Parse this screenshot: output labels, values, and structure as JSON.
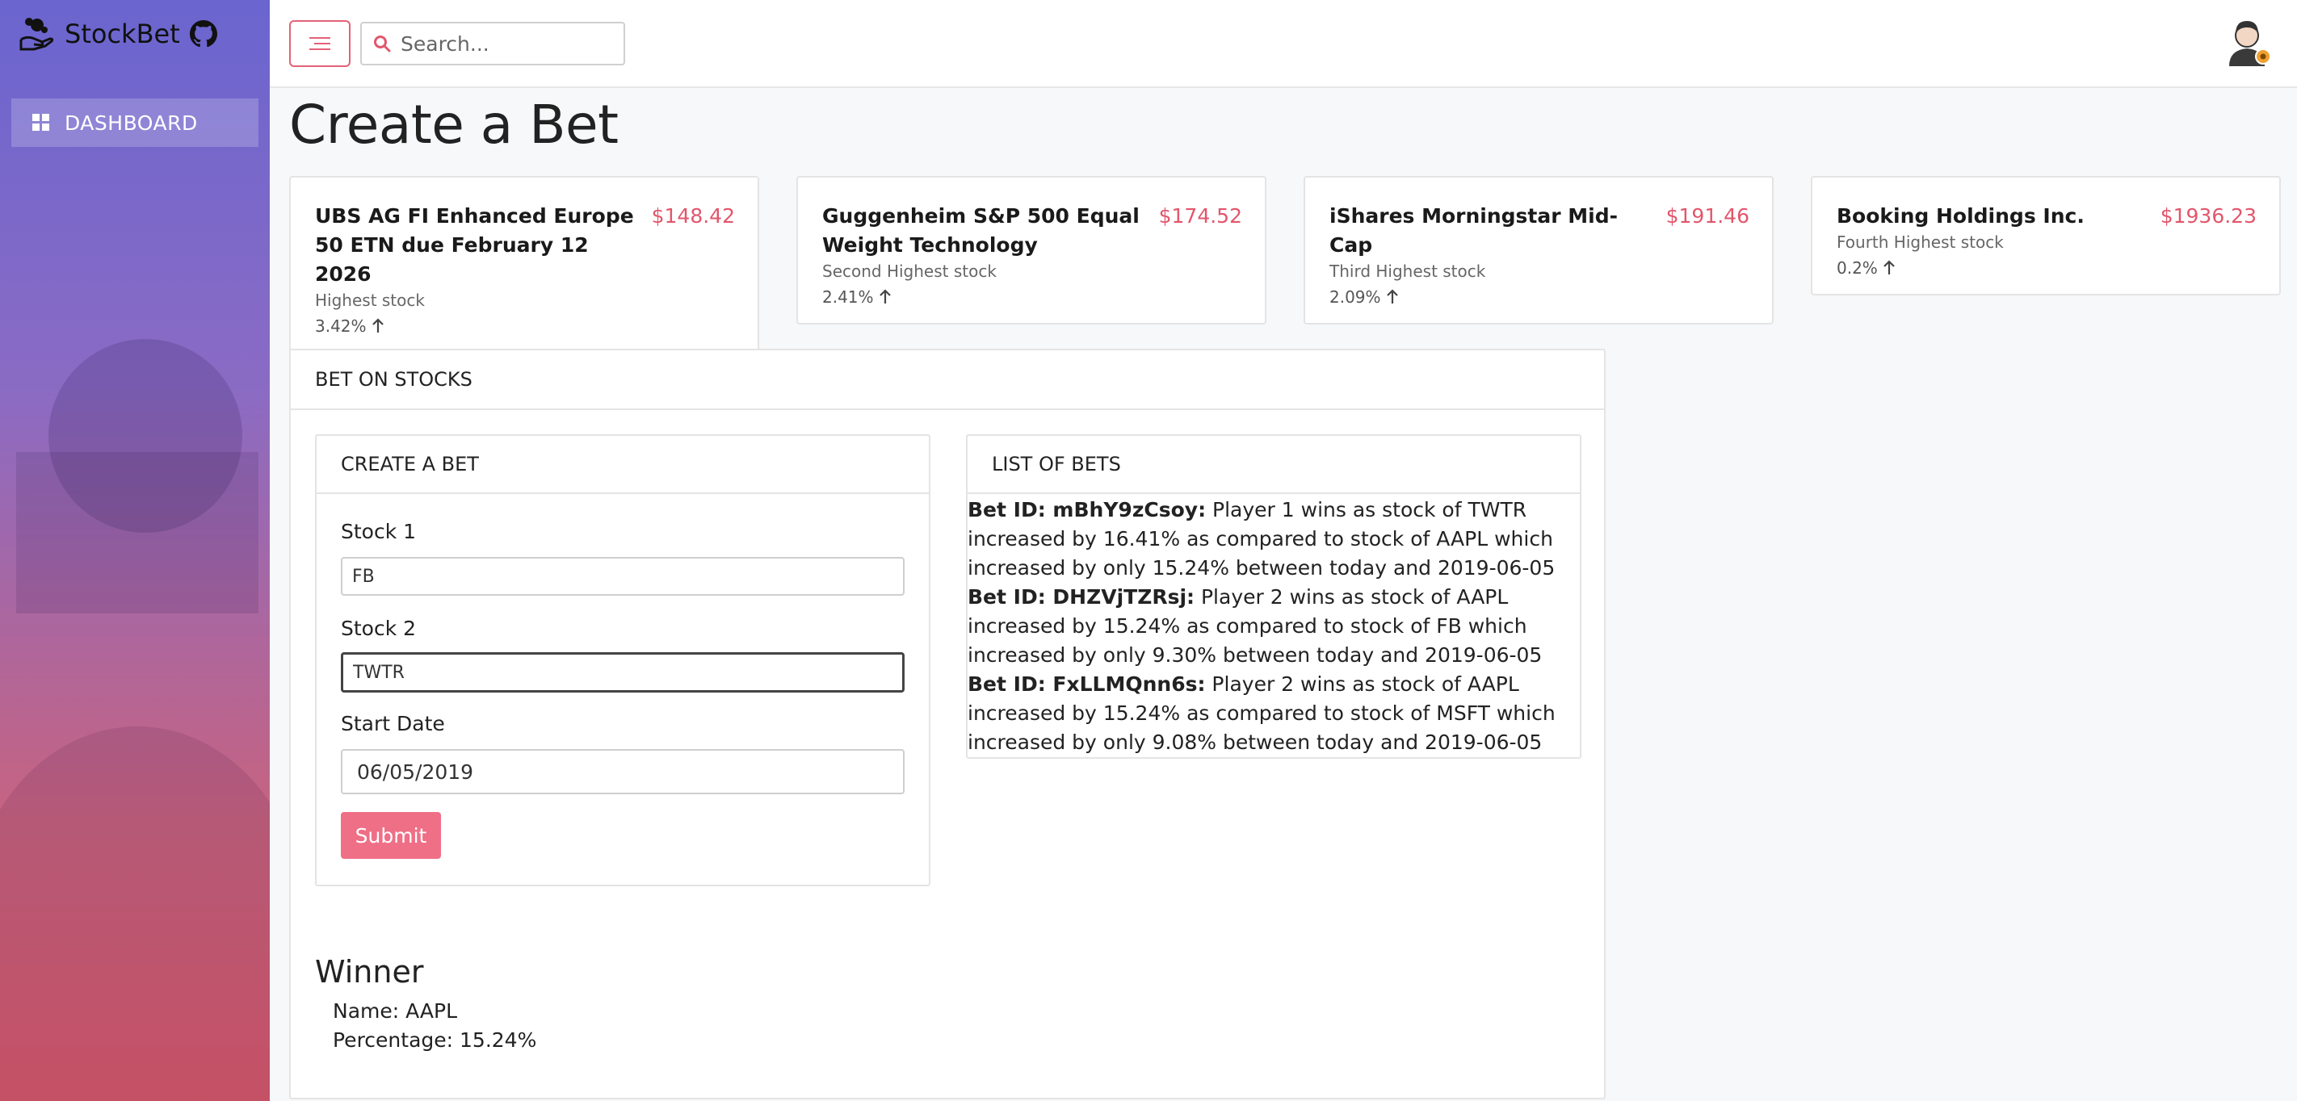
{
  "brand": {
    "name": "StockBet"
  },
  "sidebar": {
    "items": [
      {
        "label": "DASHBOARD",
        "icon": "dashboard-grid-icon"
      }
    ]
  },
  "topbar": {
    "search_placeholder": "Search..."
  },
  "page": {
    "title": "Create a Bet"
  },
  "top_stocks": [
    {
      "name": "UBS AG FI Enhanced Europe 50 ETN due February 12 2026",
      "price": "$148.42",
      "rank": "Highest stock",
      "change": "3.42%"
    },
    {
      "name": "Guggenheim S&P 500 Equal Weight Technology",
      "price": "$174.52",
      "rank": "Second Highest stock",
      "change": "2.41%"
    },
    {
      "name": "iShares Morningstar Mid-Cap",
      "price": "$191.46",
      "rank": "Third Highest stock",
      "change": "2.09%"
    },
    {
      "name": "Booking Holdings Inc.",
      "price": "$1936.23",
      "rank": "Fourth Highest stock",
      "change": "0.2%"
    }
  ],
  "bet_panel": {
    "title": "BET ON STOCKS",
    "create": {
      "title": "CREATE A BET",
      "stock1_label": "Stock 1",
      "stock1_value": "FB",
      "stock2_label": "Stock 2",
      "stock2_value": "TWTR",
      "date_label": "Start Date",
      "date_value": "06/05/2019",
      "submit_label": "Submit"
    },
    "list": {
      "title": "LIST OF BETS",
      "bets": [
        {
          "id": "Bet ID: mBhY9zCsoy:",
          "text": " Player 1 wins as stock of TWTR increased by 16.41% as compared to stock of AAPL which increased by only 15.24% between today and 2019-06-05"
        },
        {
          "id": "Bet ID: DHZVjTZRsj:",
          "text": " Player 2 wins as stock of AAPL increased by 15.24% as compared to stock of FB which increased by only 9.30% between today and 2019-06-05"
        },
        {
          "id": "Bet ID: FxLLMQnn6s:",
          "text": " Player 2 wins as stock of AAPL increased by 15.24% as compared to stock of MSFT which increased by only 9.08% between today and 2019-06-05"
        }
      ]
    },
    "winner": {
      "title": "Winner",
      "name_line": "Name: AAPL",
      "percentage_line": "Percentage: 15.24%"
    }
  },
  "colors": {
    "accent": "#e2566c",
    "submit": "#ef6f86",
    "sidebar_top": "#6a65cf",
    "sidebar_bottom": "#d95b6c"
  }
}
